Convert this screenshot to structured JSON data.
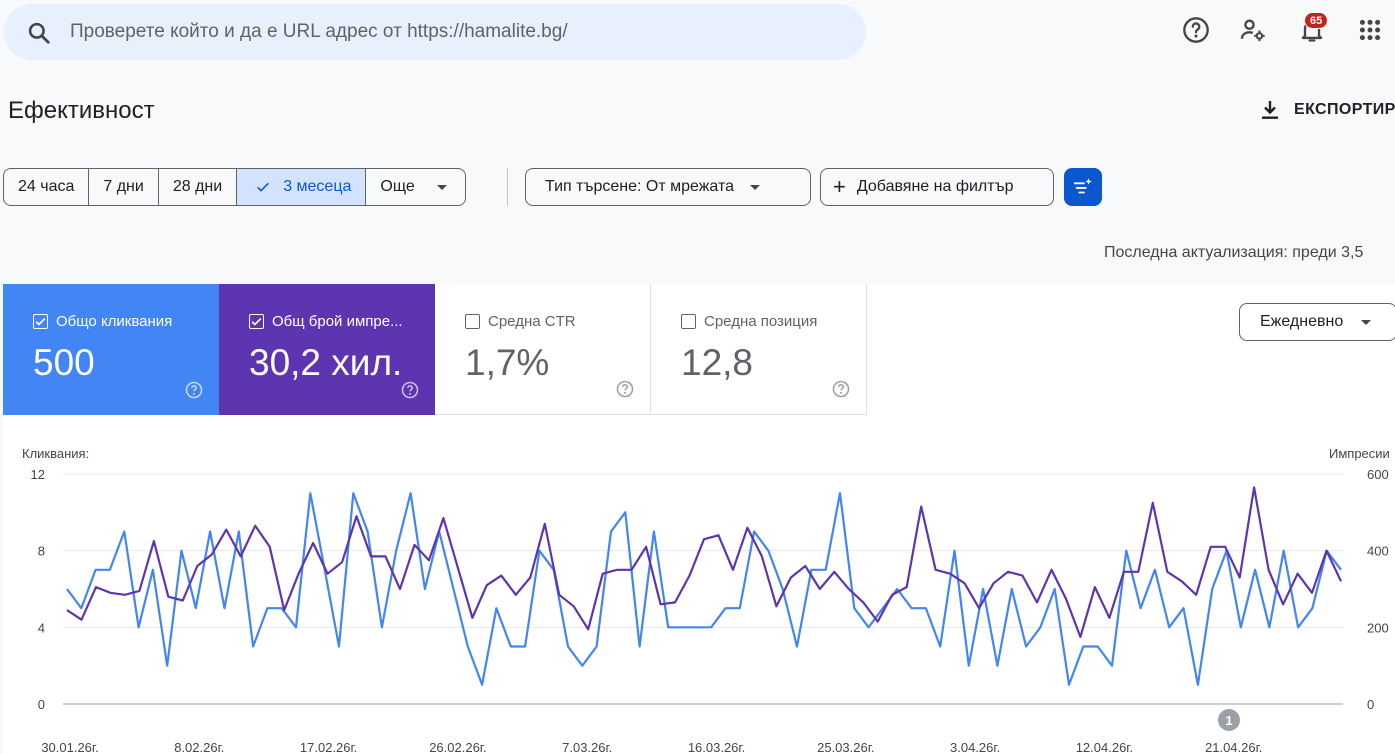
{
  "search": {
    "placeholder": "Проверете който и да е URL адрес от https://hamalite.bg/"
  },
  "header": {
    "notifications_count": "65"
  },
  "page": {
    "title": "Ефективност",
    "export_label": "ЕКСПОРТИР"
  },
  "date_range": {
    "options": [
      "24 часа",
      "7 дни",
      "28 дни",
      "3 месеца",
      "Още"
    ],
    "selected": "3 месеца"
  },
  "filters": {
    "search_type": "Тип търсене: От мрежата",
    "add_filter": "Добавяне на филтър"
  },
  "last_update": "Последна актуализация: преди 3,5",
  "metrics": {
    "clicks": {
      "label": "Общо кликвания",
      "value": "500",
      "checked": true
    },
    "impressions": {
      "label": "Общ брой импре...",
      "value": "30,2 хил.",
      "checked": true
    },
    "ctr": {
      "label": "Средна CTR",
      "value": "1,7%",
      "checked": false
    },
    "position": {
      "label": "Средна позиция",
      "value": "12,8",
      "checked": false
    }
  },
  "granularity": "Ежедневно",
  "colors": {
    "clicks": "#4285f4",
    "impressions": "#5e35b1",
    "accent": "#0b57d0"
  },
  "chart_data": {
    "type": "line",
    "ylabel_left": "Кликвания:",
    "ylabel_right": "Импресии",
    "ylim_left": [
      0,
      12
    ],
    "ylim_right": [
      0,
      600
    ],
    "yticks_left": [
      "0",
      "4",
      "8",
      "12"
    ],
    "yticks_right": [
      "0",
      "200",
      "400",
      "600"
    ],
    "xticks": [
      "30.01.26г.",
      "8.02.26г.",
      "17.02.26г.",
      "26.02.26г.",
      "7.03.26г.",
      "16.03.26г.",
      "25.03.26г.",
      "3.04.26г.",
      "12.04.26г.",
      "21.04.26г."
    ],
    "annotation": "1",
    "series": [
      {
        "name": "Кликвания:",
        "axis": "left",
        "values": [
          6,
          5,
          7,
          7,
          9,
          4,
          7,
          2,
          8,
          5,
          9,
          5,
          9,
          3,
          5,
          5,
          4,
          11,
          7,
          3,
          11,
          9,
          4,
          8,
          11,
          6,
          9,
          6,
          3,
          1,
          5,
          3,
          3,
          8,
          7,
          3,
          2,
          3,
          9,
          10,
          3,
          9,
          4,
          4,
          4,
          4,
          5,
          5,
          9,
          8,
          6,
          3,
          7,
          7,
          11,
          5,
          4,
          5,
          6,
          5,
          5,
          3,
          8,
          2,
          6,
          2,
          6,
          3,
          4,
          6,
          1,
          3,
          3,
          2,
          8,
          5,
          7,
          4,
          5,
          1,
          6,
          8,
          4,
          7,
          4,
          8,
          4,
          5,
          8,
          7
        ]
      },
      {
        "name": "Импресии",
        "axis": "right",
        "values": [
          245,
          220,
          305,
          290,
          285,
          295,
          425,
          280,
          270,
          360,
          390,
          455,
          385,
          465,
          410,
          245,
          340,
          420,
          340,
          370,
          490,
          385,
          385,
          300,
          415,
          375,
          485,
          355,
          225,
          310,
          335,
          285,
          330,
          470,
          285,
          255,
          195,
          340,
          350,
          350,
          410,
          260,
          265,
          335,
          430,
          440,
          350,
          460,
          385,
          255,
          330,
          360,
          300,
          345,
          300,
          265,
          215,
          285,
          305,
          515,
          350,
          340,
          315,
          250,
          315,
          345,
          335,
          265,
          350,
          275,
          175,
          305,
          225,
          345,
          345,
          525,
          345,
          320,
          285,
          410,
          410,
          330,
          565,
          350,
          260,
          340,
          290,
          400,
          320
        ]
      }
    ]
  }
}
